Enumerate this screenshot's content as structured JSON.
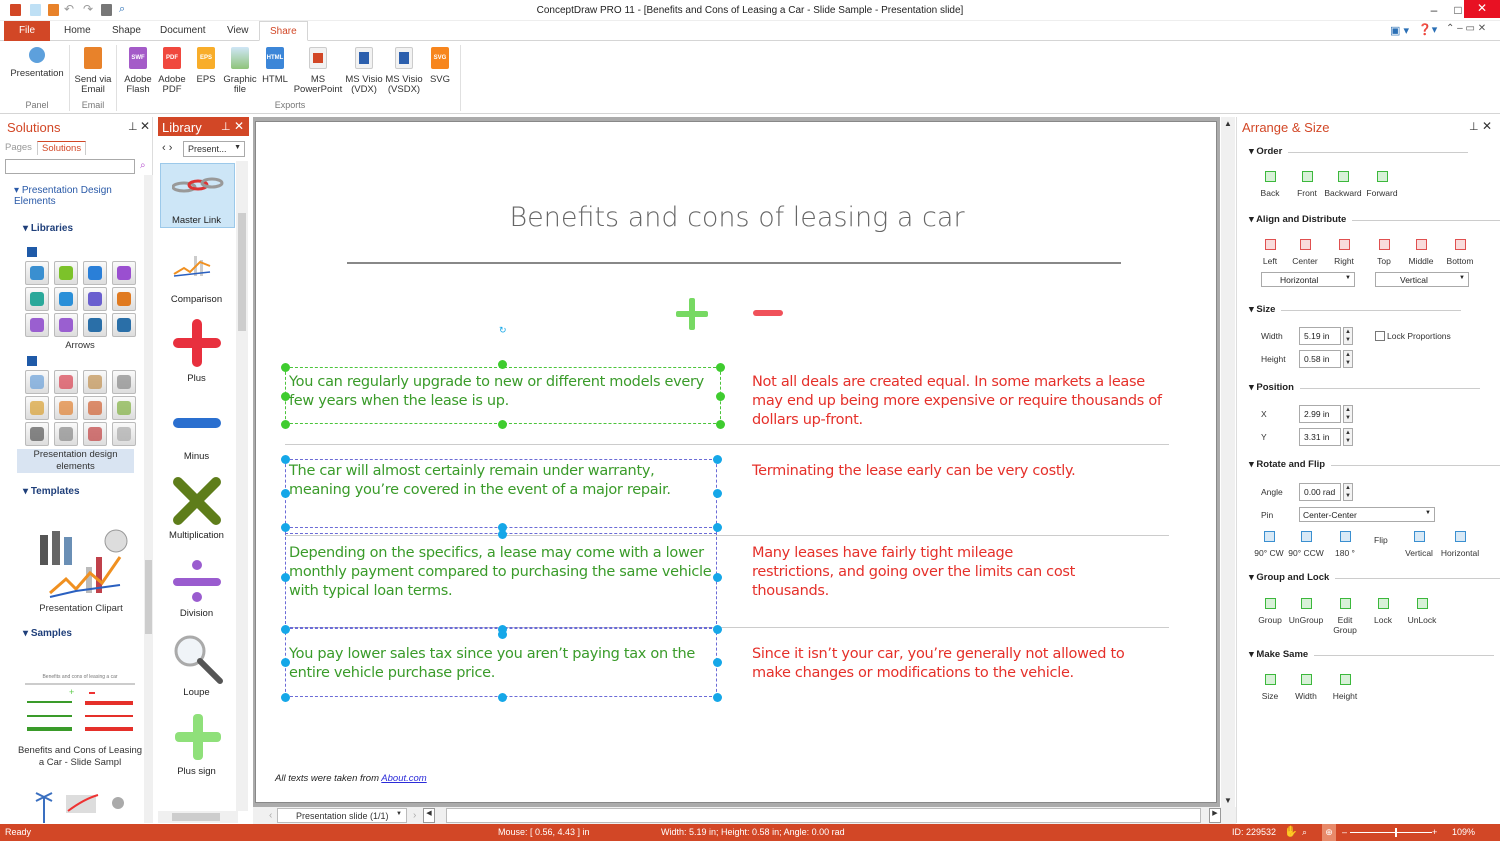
{
  "window": {
    "title": "ConceptDraw PRO 11 - [Benefits and Cons of Leasing a Car - Slide Sample - Presentation slide]"
  },
  "tabs": [
    "File",
    "Home",
    "Shape",
    "Document",
    "View",
    "Share"
  ],
  "ribbon": {
    "buttons": [
      {
        "label": "Presentation"
      },
      {
        "label": "Send via Email"
      },
      {
        "label": "Adobe Flash",
        "badge": "SWF"
      },
      {
        "label": "Adobe PDF",
        "badge": "PDF"
      },
      {
        "label": "EPS",
        "badge": "EPS"
      },
      {
        "label": "Graphic file"
      },
      {
        "label": "HTML",
        "badge": "HTML"
      },
      {
        "label": "MS PowerPoint"
      },
      {
        "label": "MS Visio (VDX)"
      },
      {
        "label": "MS Visio (VSDX)"
      },
      {
        "label": "SVG",
        "badge": "SVG"
      }
    ],
    "groups": [
      "Panel",
      "Email",
      "Exports"
    ]
  },
  "solutions": {
    "title": "Solutions",
    "tabs": [
      "Pages",
      "Solutions"
    ],
    "search_placeholder": "",
    "tree_root": "Presentation Design Elements",
    "libraries_label": "Libraries",
    "arrows_label": "Arrows",
    "pde_label": "Presentation design elements",
    "templates_label": "Templates",
    "template_item": "Presentation Clipart",
    "samples_label": "Samples",
    "sample_item": "Benefits and Cons of Leasing a Car - Slide Sampl"
  },
  "library": {
    "title": "Library",
    "dropdown": "Present...",
    "items": [
      "Master Link",
      "Comparison",
      "Plus",
      "Minus",
      "Multiplication",
      "Division",
      "Loupe",
      "Plus sign"
    ]
  },
  "slide": {
    "title": "Benefits and cons of leasing a car",
    "pros": [
      "You can regularly upgrade to new or different models every few years when the lease is up.",
      "The car will almost certainly remain under warranty, meaning you’re covered in the event of a major repair.",
      "Depending on the specifics, a lease may come with a lower monthly payment compared to purchasing the same vehicle with typical loan terms.",
      "You pay lower sales tax since you aren’t paying tax on the entire vehicle purchase price."
    ],
    "cons": [
      "Not all deals are created equal. In some markets a lease may end up being more expensive or require thousands of dollars up-front.",
      "Terminating the lease early can be very costly.",
      "Many leases have fairly tight mileage restrictions, and going over the limits can cost thousands.",
      "Since it isn’t your car, you’re generally not allowed to make changes or modifications to the vehicle."
    ],
    "footer": "All texts were taken from ",
    "footer_link": "About.com"
  },
  "page_selector": "Presentation slide (1/1)",
  "arrange": {
    "title": "Arrange & Size",
    "order": {
      "label": "Order",
      "buttons": [
        "Back",
        "Front",
        "Backward",
        "Forward"
      ]
    },
    "align": {
      "label": "Align and Distribute",
      "buttons": [
        "Left",
        "Center",
        "Right",
        "Top",
        "Middle",
        "Bottom"
      ],
      "horizontal": "Horizontal",
      "vertical": "Vertical"
    },
    "size": {
      "label": "Size",
      "width_label": "Width",
      "width": "5.19 in",
      "height_label": "Height",
      "height": "0.58 in",
      "lock": "Lock Proportions"
    },
    "position": {
      "label": "Position",
      "x_label": "X",
      "x": "2.99 in",
      "y_label": "Y",
      "y": "3.31 in"
    },
    "rotate": {
      "label": "Rotate and Flip",
      "angle_label": "Angle",
      "angle": "0.00 rad",
      "pin_label": "Pin",
      "pin": "Center-Center",
      "buttons": [
        "90° CW",
        "90° CCW",
        "180 °"
      ],
      "flip": "Flip",
      "flip_buttons": [
        "Vertical",
        "Horizontal"
      ]
    },
    "group": {
      "label": "Group and Lock",
      "buttons": [
        "Group",
        "UnGroup",
        "Edit Group",
        "Lock",
        "UnLock"
      ]
    },
    "same": {
      "label": "Make Same",
      "buttons": [
        "Size",
        "Width",
        "Height"
      ]
    }
  },
  "status": {
    "ready": "Ready",
    "mouse": "Mouse: [ 0.56, 4.43 ] in",
    "dims": "Width: 5.19 in;  Height: 0.58 in;  Angle: 0.00 rad",
    "id": "ID: 229532",
    "zoom": "109%",
    "zoom_fraction": 0.55
  },
  "colors": {
    "accent": "#d24726",
    "pro": "#3a9b2a",
    "con": "#e5302a"
  }
}
